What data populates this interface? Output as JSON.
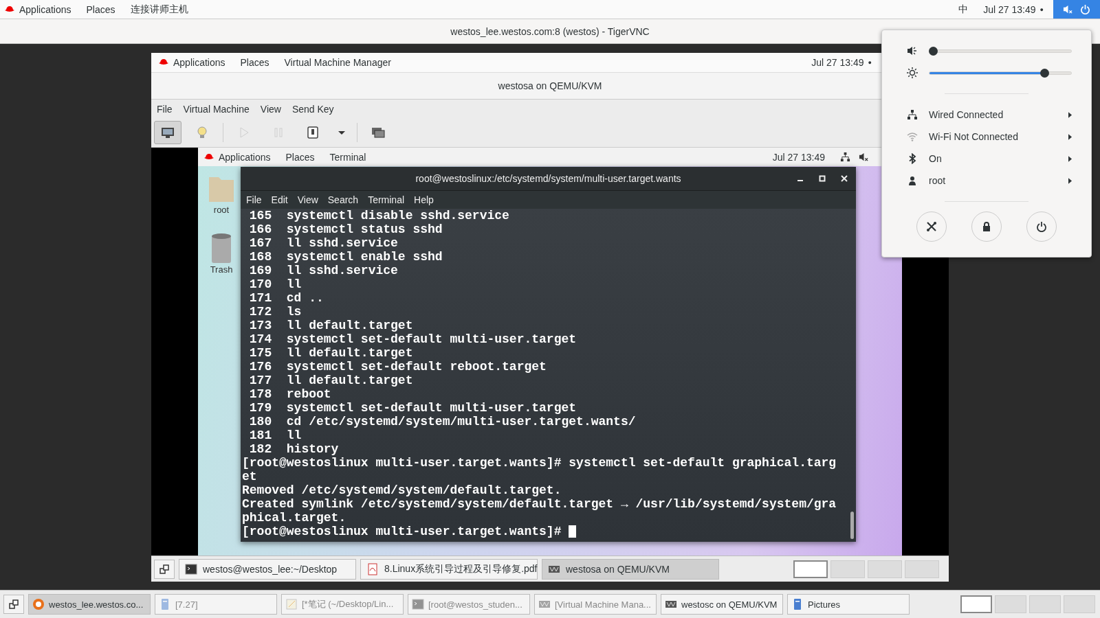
{
  "top_bar": {
    "menus": [
      "Applications",
      "Places",
      "连接讲师主机"
    ],
    "input_method": "中",
    "clock": "Jul 27  13:49",
    "indicator": "●",
    "status_menu_open": true
  },
  "vnc_window": {
    "title": "westos_lee.westos.com:8 (westos) - TigerVNC"
  },
  "vm_window": {
    "top_bar": {
      "menus": [
        "Applications",
        "Places",
        "Virtual Machine Manager"
      ],
      "clock": "Jul 27  13:49",
      "indicator": "●"
    },
    "title": "westosa on QEMU/KVM",
    "menu": [
      "File",
      "Virtual Machine",
      "View",
      "Send Key"
    ],
    "toolbar": [
      {
        "kind": "console",
        "selected": true,
        "disabled": false
      },
      {
        "kind": "details",
        "selected": false,
        "disabled": false
      },
      {
        "kind": "run",
        "selected": false,
        "disabled": true
      },
      {
        "kind": "pause",
        "selected": false,
        "disabled": true
      },
      {
        "kind": "shutdown",
        "selected": false,
        "disabled": false
      },
      {
        "kind": "dropdown",
        "selected": false,
        "disabled": false
      },
      {
        "kind": "fullscreen",
        "selected": false,
        "disabled": false
      }
    ],
    "guest": {
      "top_bar": {
        "menus": [
          "Applications",
          "Places",
          "Terminal"
        ],
        "clock": "Jul 27  13:49"
      },
      "desktop_icons": [
        {
          "kind": "folder",
          "label": "root"
        },
        {
          "kind": "trash",
          "label": "Trash"
        }
      ],
      "terminal": {
        "title": "root@westoslinux:/etc/systemd/system/multi-user.target.wants",
        "menu": [
          "File",
          "Edit",
          "View",
          "Search",
          "Terminal",
          "Help"
        ],
        "lines": [
          " 165  systemctl disable sshd.service",
          " 166  systemctl status sshd",
          " 167  ll sshd.service",
          " 168  systemctl enable sshd",
          " 169  ll sshd.service",
          " 170  ll",
          " 171  cd ..",
          " 172  ls",
          " 173  ll default.target",
          " 174  systemctl set-default multi-user.target",
          " 175  ll default.target",
          " 176  systemctl set-default reboot.target",
          " 177  ll default.target",
          " 178  reboot",
          " 179  systemctl set-default multi-user.target",
          " 180  cd /etc/systemd/system/multi-user.target.wants/",
          " 181  ll",
          " 182  history",
          "[root@westoslinux multi-user.target.wants]# systemctl set-default graphical.targ",
          "et",
          "Removed /etc/systemd/system/default.target.",
          "Created symlink /etc/systemd/system/default.target → /usr/lib/systemd/system/gra",
          "phical.target.",
          "[root@westoslinux multi-user.target.wants]# "
        ]
      }
    },
    "taskbar": {
      "items": [
        {
          "kind": "terminal",
          "label": "westos@westos_lee:~/Desktop",
          "selected": false
        },
        {
          "kind": "pdf",
          "label": "8.Linux系统引导过程及引导修复.pdf",
          "selected": false
        },
        {
          "kind": "vm",
          "label": "westosa on QEMU/KVM",
          "selected": true
        }
      ],
      "workspaces": [
        {
          "selected": true
        },
        {
          "selected": false
        },
        {
          "selected": false
        },
        {
          "selected": false
        }
      ]
    }
  },
  "taskbar": {
    "items": [
      {
        "kind": "browser",
        "label": "westos_lee.westos.co...",
        "selected": true,
        "minimized": false
      },
      {
        "kind": "document",
        "label": "[7.27]",
        "selected": false,
        "minimized": true
      },
      {
        "kind": "editor",
        "label": "[*笔记 (~/Desktop/Lin...",
        "selected": false,
        "minimized": true
      },
      {
        "kind": "terminal",
        "label": "[root@westos_studen...",
        "selected": false,
        "minimized": true
      },
      {
        "kind": "vm",
        "label": "[Virtual Machine Mana...",
        "selected": false,
        "minimized": true
      },
      {
        "kind": "vm",
        "label": "westosc on QEMU/KVM",
        "selected": false,
        "minimized": false
      },
      {
        "kind": "document",
        "label": "Pictures",
        "selected": false,
        "minimized": false
      }
    ],
    "workspaces": [
      {
        "selected": true
      },
      {
        "selected": false
      },
      {
        "selected": false
      },
      {
        "selected": false
      }
    ]
  },
  "status_menu": {
    "sliders": [
      {
        "kind": "volume",
        "level": 0
      },
      {
        "kind": "brightness",
        "level": 0.83
      }
    ],
    "rows": [
      {
        "kind": "wired",
        "label": "Wired Connected"
      },
      {
        "kind": "wifi",
        "label": "Wi-Fi Not Connected"
      },
      {
        "kind": "bluetooth",
        "label": "On"
      },
      {
        "kind": "user",
        "label": "root"
      }
    ],
    "buttons": [
      {
        "kind": "settings"
      },
      {
        "kind": "lock"
      },
      {
        "kind": "power"
      }
    ]
  }
}
